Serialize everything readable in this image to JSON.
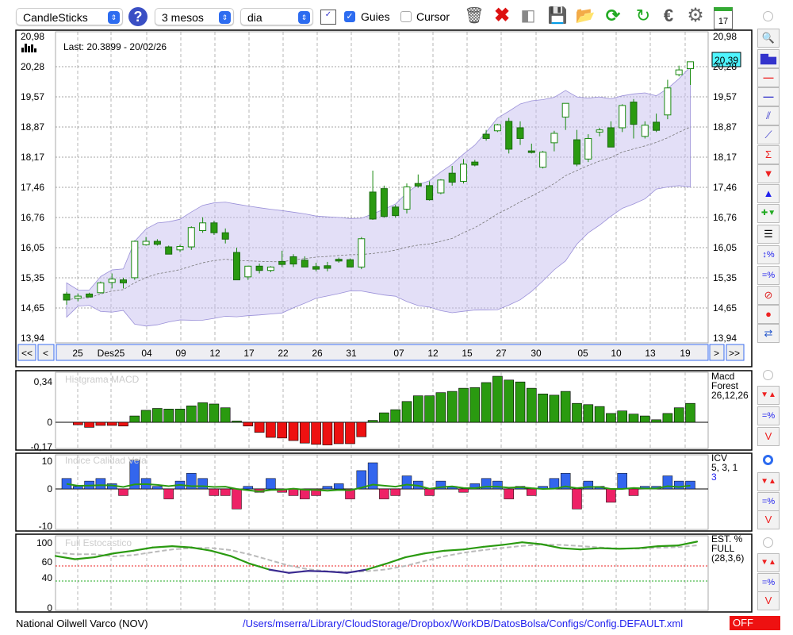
{
  "toolbar": {
    "chart_type": "CandleSticks",
    "period": "3 mesos",
    "interval": "dia",
    "guies_label": "Guies",
    "guies_checked": true,
    "cursor_label": "Cursor",
    "cursor_checked": false,
    "icons": [
      "trash-icon",
      "delete-icon",
      "lamp-icon",
      "save-icon",
      "folder-open-icon",
      "refresh-icon",
      "update-icon",
      "euro-icon",
      "gear-icon",
      "calendar-icon"
    ],
    "calendar_day": "17"
  },
  "main_chart": {
    "last_label": "Last: 20.3899 - 20/02/26",
    "current_price": "20,39",
    "current_price_color": "#4ff5ff",
    "y_labels": [
      "20,98",
      "20,28",
      "19,57",
      "18,87",
      "18,17",
      "17,46",
      "16,76",
      "16,05",
      "15,35",
      "14,65",
      "13,94"
    ],
    "y_min": 13.94,
    "y_max": 20.98,
    "candles": [
      [
        14.97,
        15.02,
        14.72,
        14.83
      ],
      [
        14.87,
        14.98,
        14.8,
        14.92
      ],
      [
        14.97,
        15.0,
        14.9,
        14.9
      ],
      [
        15.0,
        15.26,
        14.98,
        15.23
      ],
      [
        15.24,
        15.45,
        15.1,
        15.32
      ],
      [
        15.3,
        15.35,
        15.1,
        15.23
      ],
      [
        15.35,
        16.22,
        15.3,
        16.2
      ],
      [
        16.12,
        16.3,
        16.1,
        16.2
      ],
      [
        16.2,
        16.25,
        16.1,
        16.13
      ],
      [
        16.07,
        16.1,
        15.9,
        15.9
      ],
      [
        16.0,
        16.12,
        15.95,
        16.08
      ],
      [
        16.07,
        16.55,
        16.0,
        16.52
      ],
      [
        16.45,
        16.76,
        16.4,
        16.63
      ],
      [
        16.63,
        16.68,
        16.35,
        16.4
      ],
      [
        16.4,
        16.5,
        16.15,
        16.25
      ],
      [
        15.94,
        16.05,
        15.3,
        15.3
      ],
      [
        15.37,
        15.63,
        15.3,
        15.62
      ],
      [
        15.62,
        15.68,
        15.45,
        15.52
      ],
      [
        15.52,
        15.62,
        15.48,
        15.6
      ],
      [
        15.73,
        15.98,
        15.6,
        15.66
      ],
      [
        15.84,
        15.9,
        15.6,
        15.67
      ],
      [
        15.76,
        15.85,
        15.6,
        15.6
      ],
      [
        15.61,
        15.7,
        15.5,
        15.55
      ],
      [
        15.63,
        15.72,
        15.5,
        15.57
      ],
      [
        15.78,
        15.82,
        15.7,
        15.74
      ],
      [
        15.77,
        15.8,
        15.6,
        15.6
      ],
      [
        15.6,
        16.3,
        15.55,
        16.26
      ],
      [
        17.35,
        17.85,
        16.7,
        16.72
      ],
      [
        17.43,
        17.5,
        16.75,
        16.78
      ],
      [
        17.0,
        17.05,
        16.75,
        16.8
      ],
      [
        16.95,
        17.55,
        16.85,
        17.47
      ],
      [
        17.55,
        17.76,
        17.45,
        17.49
      ],
      [
        17.5,
        17.6,
        17.15,
        17.17
      ],
      [
        17.33,
        17.65,
        17.3,
        17.63
      ],
      [
        17.79,
        17.96,
        17.5,
        17.58
      ],
      [
        17.6,
        18.12,
        17.55,
        18.0
      ],
      [
        18.05,
        18.1,
        17.95,
        17.98
      ],
      [
        18.7,
        18.8,
        18.55,
        18.6
      ],
      [
        18.78,
        18.94,
        18.75,
        18.92
      ],
      [
        19.0,
        19.08,
        18.25,
        18.35
      ],
      [
        18.85,
        19.0,
        18.45,
        18.6
      ],
      [
        18.31,
        18.48,
        18.25,
        18.28
      ],
      [
        17.93,
        18.31,
        17.9,
        18.28
      ],
      [
        18.5,
        18.78,
        18.3,
        18.72
      ],
      [
        19.1,
        19.32,
        18.8,
        19.42
      ],
      [
        18.57,
        18.8,
        17.95,
        18.0
      ],
      [
        18.12,
        18.7,
        18.05,
        18.6
      ],
      [
        18.75,
        18.85,
        18.65,
        18.8
      ],
      [
        18.85,
        19.0,
        18.4,
        18.4
      ],
      [
        18.85,
        19.4,
        18.75,
        19.37
      ],
      [
        19.45,
        19.52,
        18.6,
        18.93
      ],
      [
        18.65,
        19.0,
        18.6,
        18.91
      ],
      [
        18.98,
        19.18,
        18.75,
        18.79
      ],
      [
        19.15,
        19.97,
        19.05,
        19.78
      ],
      [
        20.09,
        20.3,
        20.05,
        20.2
      ],
      [
        20.23,
        20.36,
        19.85,
        20.39
      ]
    ],
    "date_labels": [
      "25",
      "Des25",
      "04",
      "09",
      "12",
      "17",
      "22",
      "26",
      "31",
      "07",
      "12",
      "15",
      "27",
      "30",
      "05",
      "10",
      "13",
      "19"
    ],
    "nav": {
      "first": "<<",
      "prev": "<",
      "next": ">",
      "last": ">>"
    }
  },
  "macd": {
    "title": "Histgrama MACD",
    "legend": [
      "Macd",
      "Forest",
      "26,12,26"
    ],
    "y_labels": [
      "0,34",
      "0",
      "-0,17"
    ],
    "values": [
      -0.02,
      -0.04,
      -0.025,
      -0.025,
      -0.03,
      0.05,
      0.095,
      0.11,
      0.105,
      0.105,
      0.13,
      0.155,
      0.145,
      0.115,
      0.01,
      -0.03,
      -0.08,
      -0.12,
      -0.125,
      -0.145,
      -0.165,
      -0.175,
      -0.18,
      -0.17,
      -0.17,
      -0.115,
      0.015,
      0.075,
      0.1,
      0.165,
      0.21,
      0.21,
      0.235,
      0.245,
      0.27,
      0.275,
      0.315,
      0.365,
      0.335,
      0.32,
      0.27,
      0.225,
      0.215,
      0.245,
      0.15,
      0.14,
      0.125,
      0.07,
      0.09,
      0.065,
      0.05,
      0.02,
      0.07,
      0.115,
      0.15
    ],
    "positive_color": "#2a9a10",
    "negative_color": "#ee1111"
  },
  "icv": {
    "title": "Indice Calidad Vela",
    "legend": [
      "ICV",
      "5, 3, 1",
      "3"
    ],
    "y_labels": [
      "10",
      "0",
      "-10"
    ],
    "values": [
      4,
      1,
      3,
      4,
      2,
      -2,
      11,
      4,
      1,
      -3,
      3,
      6,
      4,
      -2,
      -2,
      -6,
      1,
      -1,
      4,
      -1,
      -2,
      -3,
      -2,
      1,
      2,
      -3,
      7,
      10,
      -3,
      -2,
      5,
      3,
      -2,
      3,
      1,
      -1,
      2,
      4,
      3,
      -3,
      1,
      -2,
      1,
      4,
      6,
      -6,
      3,
      1,
      -4,
      6,
      -2,
      1,
      1,
      5,
      3,
      3
    ],
    "positive_color": "#3366ee",
    "negative_color": "#ee2266"
  },
  "stoch": {
    "title": "Full Estocastico",
    "legend": [
      "EST. %",
      "FULL",
      "(28,3,6)"
    ],
    "y_labels": [
      "100",
      "60",
      "40",
      "0"
    ],
    "k_values": [
      80,
      75,
      78,
      84,
      88,
      93,
      95,
      93,
      88,
      80,
      68,
      59,
      54,
      57,
      56,
      54,
      59,
      68,
      78,
      84,
      88,
      90,
      94,
      97,
      101,
      98,
      92,
      90,
      92,
      91,
      92,
      95,
      96,
      102
    ]
  },
  "footer": {
    "company": "National Oilwell Varco (NOV)",
    "path": "/Users/mserra/Library/CloudStorage/Dropbox/WorkDB/DatosBolsa/Configs/Config.DEFAULT.xml",
    "status": "OFF",
    "status_color": "#ee1111"
  }
}
